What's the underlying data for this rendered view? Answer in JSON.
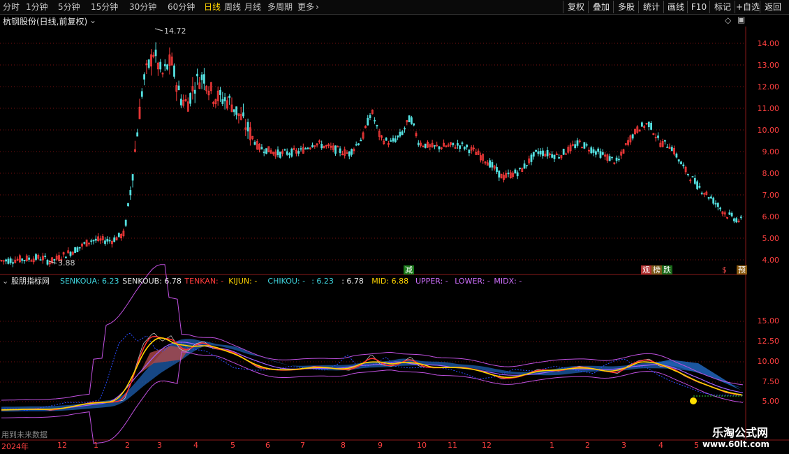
{
  "toolbar": {
    "periods": [
      "分时",
      "1分钟",
      "5分钟",
      "15分钟",
      "30分钟",
      "60分钟",
      "日线",
      "周线",
      "月线",
      "多周期",
      "更多"
    ],
    "active_period": "日线",
    "more_icon": "chevron-right-icon",
    "right_buttons": [
      "复权",
      "叠加",
      "多股",
      "统计",
      "画线",
      "F10",
      "标记",
      "+自选",
      "返回"
    ]
  },
  "main_chart": {
    "title": "杭钢股份(日线,前复权)",
    "y_ticks": [
      "14.00",
      "13.00",
      "12.00",
      "11.00",
      "10.00",
      "9.00",
      "8.00",
      "7.00",
      "6.00",
      "5.00",
      "4.00"
    ],
    "high_label": "14.72",
    "low_label": "3.88",
    "signals": [
      "减",
      "观",
      "榜",
      "跌",
      "$",
      "预"
    ],
    "colors": {
      "up": "#ff3b3b",
      "down": "#54e0e0",
      "grid": "#7a1010",
      "axis": "#ff4040"
    }
  },
  "indicator": {
    "name": "股朋指标网",
    "fields": [
      {
        "label": "SENKOUA:",
        "value": "6.23",
        "color": "#3fd7e0"
      },
      {
        "label": "SENKOUB:",
        "value": "6.78",
        "color": "#e8e8e8"
      },
      {
        "label": "TENKAN:",
        "value": "-",
        "color": "#ff3b3b"
      },
      {
        "label": "KIJUN:",
        "value": "-",
        "color": "#ffd400"
      },
      {
        "label": "CHIKOU:",
        "value": "-",
        "color": "#3fd7e0"
      },
      {
        "label": ":",
        "value": "6.23",
        "color": "#3fd7e0"
      },
      {
        "label": ":",
        "value": "6.78",
        "color": "#e8e8e8"
      },
      {
        "label": "MID:",
        "value": "6.88",
        "color": "#ffd400"
      },
      {
        "label": "UPPER:",
        "value": "-",
        "color": "#d070ff"
      },
      {
        "label": "LOWER:",
        "value": "-",
        "color": "#d070ff"
      },
      {
        "label": "MIDX:",
        "value": "-",
        "color": "#d070ff"
      }
    ],
    "y_ticks": [
      "15.00",
      "12.50",
      "10.00",
      "7.50",
      "5.00"
    ],
    "note": "用到未来数据"
  },
  "x_axis": {
    "labels": [
      "2024年",
      "12",
      "1",
      "2",
      "3",
      "4",
      "5",
      "6",
      "7",
      "8",
      "9",
      "10",
      "11",
      "12",
      "1",
      "2",
      "3",
      "4",
      "5"
    ]
  },
  "watermark": {
    "line1": "乐淘公式网",
    "line2": "www.60lt.com"
  }
}
